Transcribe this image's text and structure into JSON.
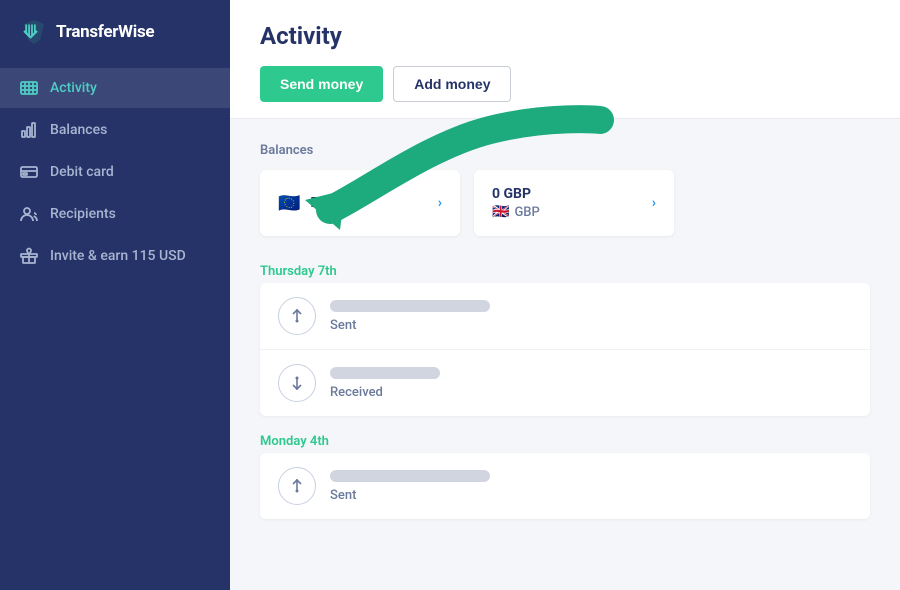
{
  "app": {
    "name": "TransferWise",
    "logo_symbol": "⟱"
  },
  "sidebar": {
    "items": [
      {
        "id": "activity",
        "label": "Activity",
        "icon": "activity",
        "active": true
      },
      {
        "id": "balances",
        "label": "Balances",
        "icon": "bar-chart",
        "active": false
      },
      {
        "id": "debit-card",
        "label": "Debit card",
        "icon": "credit-card",
        "active": false
      },
      {
        "id": "recipients",
        "label": "Recipients",
        "icon": "users",
        "active": false
      },
      {
        "id": "invite",
        "label": "Invite & earn 115 USD",
        "icon": "gift",
        "active": false
      }
    ]
  },
  "main": {
    "page_title": "Activity",
    "buttons": {
      "send": "Send money",
      "add": "Add money"
    },
    "balances_label": "Balances",
    "balances": [
      {
        "currency": "EUR",
        "flag": "🇪🇺",
        "amount": null
      },
      {
        "currency": "GBP",
        "flag": "🇬🇧",
        "amount": "0 GBP"
      }
    ],
    "days": [
      {
        "label": "Thursday 7th",
        "transactions": [
          {
            "type": "sent",
            "status": "Sent"
          },
          {
            "type": "received",
            "status": "Received"
          }
        ]
      },
      {
        "label": "Monday 4th",
        "transactions": [
          {
            "type": "sent",
            "status": "Sent"
          }
        ]
      }
    ]
  }
}
